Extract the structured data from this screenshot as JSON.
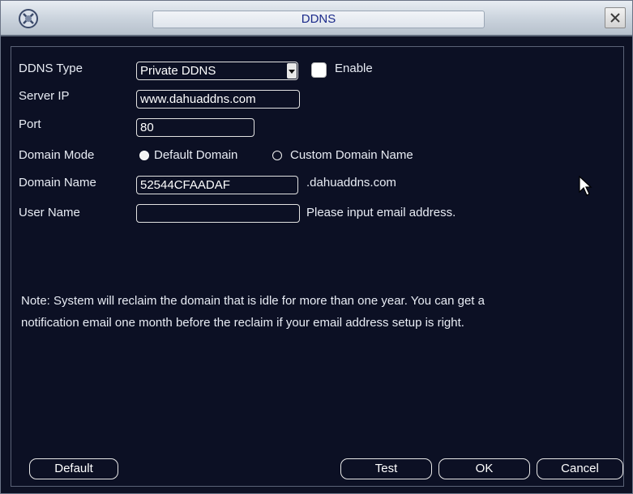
{
  "window": {
    "title": "DDNS"
  },
  "form": {
    "ddns_type": {
      "label": "DDNS Type",
      "value": "Private DDNS"
    },
    "enable": {
      "label": "Enable",
      "checked": false
    },
    "server_ip": {
      "label": "Server IP",
      "value": "www.dahuaddns.com"
    },
    "port": {
      "label": "Port",
      "value": "80"
    },
    "domain_mode": {
      "label": "Domain Mode",
      "options": [
        "Default Domain",
        "Custom Domain Name"
      ],
      "selected": "Default Domain"
    },
    "domain_name": {
      "label": "Domain Name",
      "value": "52544CFAADAF",
      "suffix": ".dahuaddns.com"
    },
    "user_name": {
      "label": "User Name",
      "value": "",
      "hint": "Please input email address."
    }
  },
  "note": {
    "line1": "Note: System will reclaim the domain that is idle for more than one year. You can get a",
    "line2": "notification email one month before the reclaim if your email address setup is right."
  },
  "buttons": {
    "default": "Default",
    "test": "Test",
    "ok": "OK",
    "cancel": "Cancel"
  },
  "colors": {
    "background": "#0c1024",
    "text": "#e8ecf4",
    "title_text": "#1b2a8a"
  },
  "icons": {
    "logo": "app-logo-icon",
    "close": "close-icon",
    "dropdown": "chevron-down-icon",
    "cursor": "mouse-pointer-icon"
  }
}
